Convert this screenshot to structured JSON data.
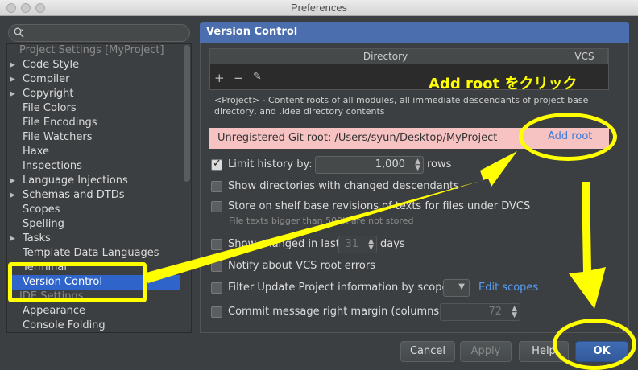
{
  "window": {
    "title": "Preferences"
  },
  "search": {
    "placeholder": ""
  },
  "tree": {
    "items": [
      {
        "label": "Project Settings [MyProject]",
        "kind": "header"
      },
      {
        "label": "Code Style",
        "arrow": "▶"
      },
      {
        "label": "Compiler",
        "arrow": "▶"
      },
      {
        "label": "Copyright",
        "arrow": "▶"
      },
      {
        "label": "File Colors"
      },
      {
        "label": "File Encodings"
      },
      {
        "label": "File Watchers"
      },
      {
        "label": "Haxe"
      },
      {
        "label": "Inspections"
      },
      {
        "label": "Language Injections",
        "arrow": "▶"
      },
      {
        "label": "Schemas and DTDs",
        "arrow": "▶"
      },
      {
        "label": "Scopes"
      },
      {
        "label": "Spelling"
      },
      {
        "label": "Tasks",
        "arrow": "▶"
      },
      {
        "label": "Template Data Languages"
      },
      {
        "label": "Terminal"
      },
      {
        "label": "Version Control",
        "selected": true
      },
      {
        "label": "IDE Settings",
        "kind": "header"
      },
      {
        "label": "Appearance"
      },
      {
        "label": "Console Folding"
      }
    ]
  },
  "panel": {
    "title": "Version Control",
    "table": {
      "col_directory": "Directory",
      "col_vcs": "VCS"
    },
    "toolbar": {
      "add": "+",
      "remove": "−",
      "edit": "✎"
    },
    "description": "<Project> - Content roots of all modules, all immediate descendants of project base directory, and .idea directory contents",
    "warning": {
      "text": "Unregistered Git root: /Users/syun/Desktop/MyProject",
      "action": "Add root"
    },
    "options": {
      "limit_history": {
        "label": "Limit history by:",
        "value": "1,000",
        "suffix": "rows",
        "checked": true
      },
      "show_dirs": {
        "label": "Show directories with changed descendants",
        "checked": false
      },
      "store_shelf": {
        "label": "Store on shelf base revisions of texts for files under DVCS",
        "checked": false,
        "hint": "File texts bigger than 500K are not stored"
      },
      "show_changed": {
        "label": "Show changed in last",
        "value": "31",
        "suffix": "days",
        "checked": false
      },
      "notify_root_errors": {
        "label": "Notify about VCS root errors",
        "checked": false
      },
      "filter_update": {
        "label": "Filter Update Project information by scope",
        "link": "Edit scopes",
        "checked": false
      },
      "commit_margin": {
        "label": "Commit message right margin (columns):",
        "value": "72",
        "checked": false
      }
    }
  },
  "buttons": {
    "cancel": "Cancel",
    "apply": "Apply",
    "help": "Help",
    "ok": "OK"
  },
  "annotation": {
    "text": "Add root をクリック",
    "color": "#ffff00"
  },
  "colors": {
    "selection": "#2f65ca",
    "header_blue": "#4b6eaf",
    "warning_bg": "#f6c2c2",
    "link": "#589df6"
  }
}
